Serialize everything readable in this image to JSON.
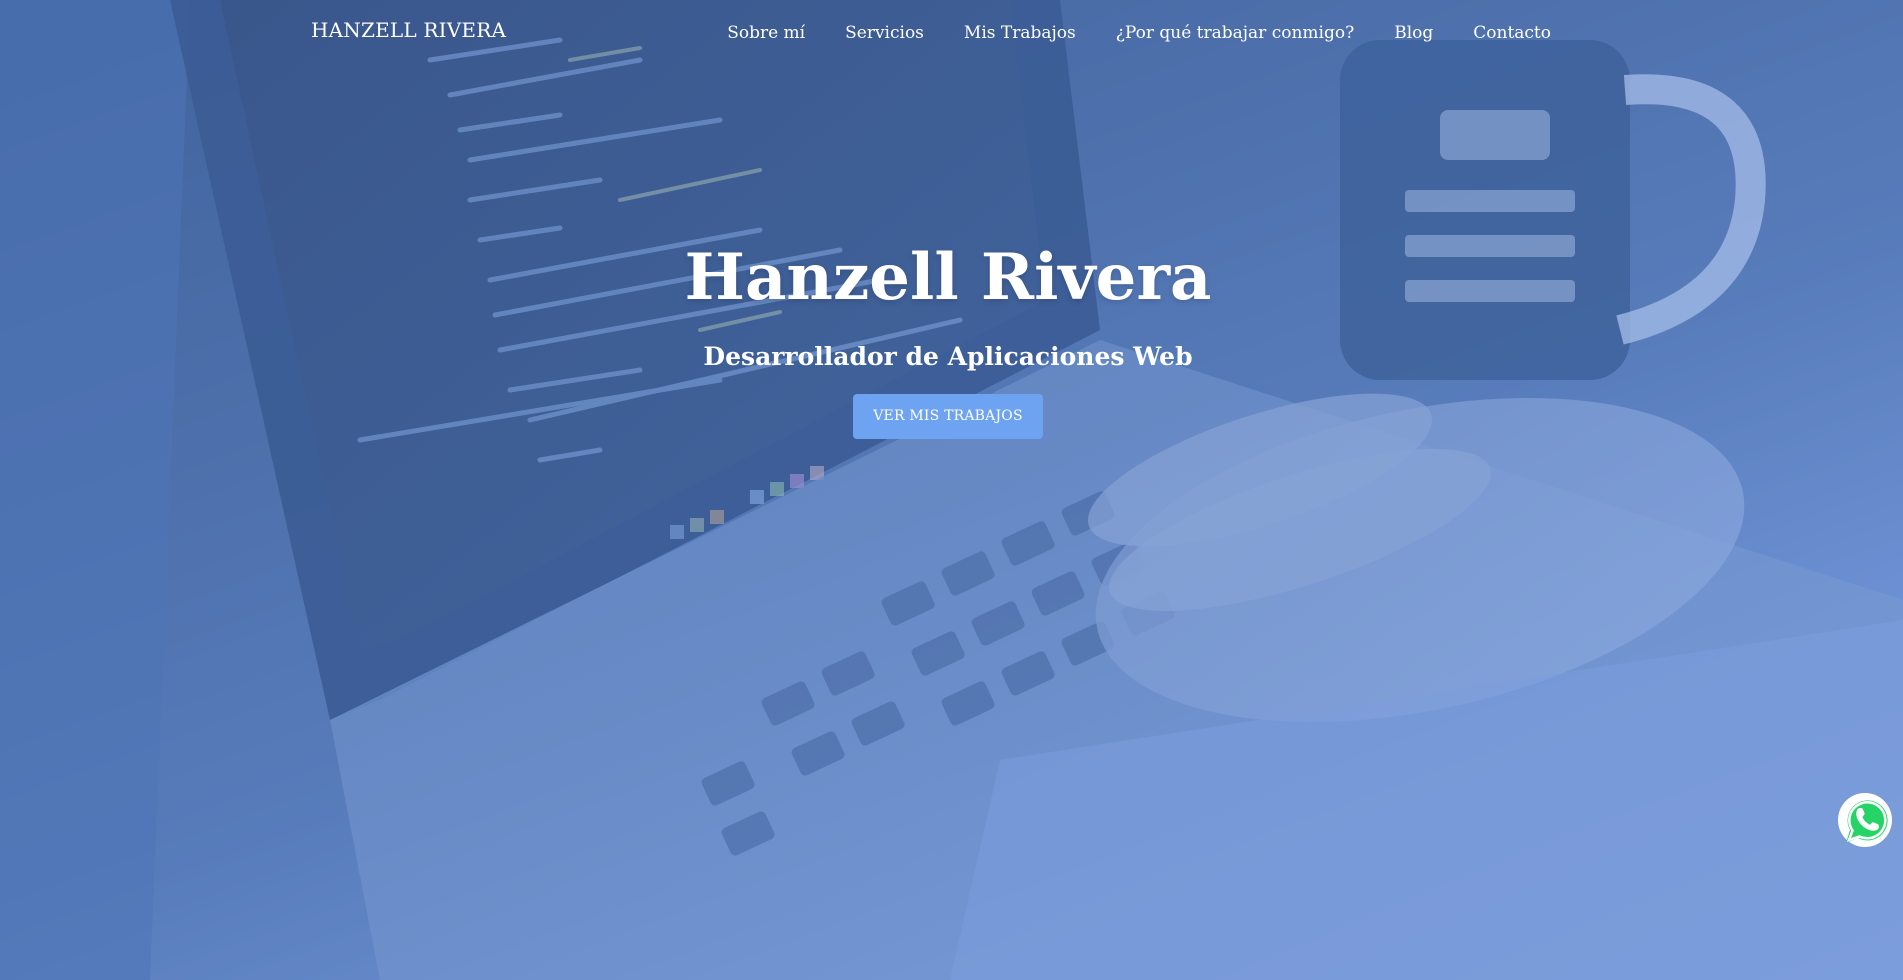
{
  "brand": {
    "name": "HANZELL RIVERA"
  },
  "nav": {
    "items": [
      {
        "label": "Sobre mí"
      },
      {
        "label": "Servicios"
      },
      {
        "label": "Mis Trabajos"
      },
      {
        "label": "¿Por qué trabajar conmigo?"
      },
      {
        "label": "Blog"
      },
      {
        "label": "Contacto"
      }
    ]
  },
  "hero": {
    "title": "Hanzell Rivera",
    "subtitle": "Desarrollador de Aplicaciones Web",
    "cta_label": "VER MIS TRABAJOS"
  },
  "floating": {
    "whatsapp_icon": "whatsapp-icon"
  },
  "colors": {
    "overlay": "#5484d6",
    "cta_background": "#6ea3f2",
    "whatsapp_green": "#25d366"
  }
}
